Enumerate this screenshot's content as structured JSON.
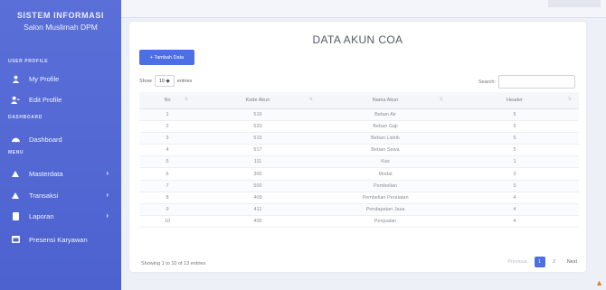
{
  "sidebar": {
    "title": "SISTEM INFORMASI",
    "subtitle": "Salon Muslimah DPM",
    "sections": {
      "user_profile": "USER PROFILE",
      "dashboard": "DASHBOARD",
      "menu": "MENU"
    },
    "items": [
      {
        "label": "My Profile",
        "icon": "user-icon"
      },
      {
        "label": "Edit Profile",
        "icon": "user-edit-icon"
      },
      {
        "label": "Dashboard",
        "icon": "dashboard-icon"
      },
      {
        "label": "Masterdata",
        "icon": "triangle-icon"
      },
      {
        "label": "Transaksi",
        "icon": "triangle-icon"
      },
      {
        "label": "Laporan",
        "icon": "file-icon"
      },
      {
        "label": "Presensi Karyawan",
        "icon": "calendar-icon"
      }
    ]
  },
  "page": {
    "title": "DATA AKUN COA",
    "add_button": "+ Tambah Data",
    "show_label": "Show",
    "entries_value": "10 ◆",
    "entries_label": "entries",
    "search_label": "Search:"
  },
  "table": {
    "headers": [
      "No",
      "Kode Akun",
      "Nama Akun",
      "Header"
    ],
    "rows": [
      [
        "1",
        "516",
        "Beban Air",
        "5"
      ],
      [
        "2",
        "520",
        "Beban Gaji",
        "5"
      ],
      [
        "3",
        "515",
        "Beban Listrik",
        "5"
      ],
      [
        "4",
        "517",
        "Beban Sewa",
        "5"
      ],
      [
        "5",
        "111",
        "Kas",
        "1"
      ],
      [
        "6",
        "300",
        "Modal",
        "3"
      ],
      [
        "7",
        "500",
        "Pembelian",
        "5"
      ],
      [
        "8",
        "409",
        "Pembelian Peralatan",
        "4"
      ],
      [
        "9",
        "411",
        "Pendapatan Jasa",
        "4"
      ],
      [
        "10",
        "400",
        "Penjualan",
        "4"
      ]
    ]
  },
  "footer": {
    "info": "Showing 1 to 10 of 13 entries",
    "previous": "Previous",
    "pages": [
      "1",
      "2"
    ],
    "next": "Next"
  },
  "colors": {
    "sidebar": "#5068d6",
    "primary": "#4e6ee4"
  }
}
